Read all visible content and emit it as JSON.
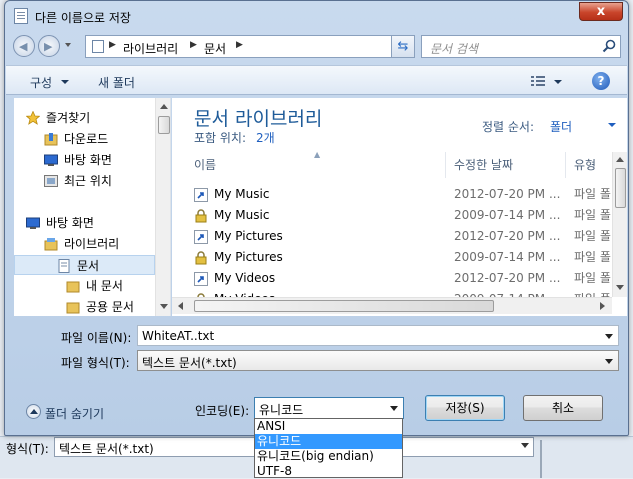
{
  "window": {
    "title": "다른 이름으로 저장",
    "close_label": "x"
  },
  "address": {
    "crumbs": [
      "라이브러리",
      "문서"
    ],
    "search_placeholder": "문서 검색"
  },
  "toolbar": {
    "organize": "구성",
    "new_folder": "새 폴더",
    "help": "?"
  },
  "nav": {
    "items": [
      {
        "label": "즐겨찾기",
        "icon": "star-icon"
      },
      {
        "label": "다운로드",
        "icon": "download-folder-icon"
      },
      {
        "label": "바탕 화면",
        "icon": "desktop-icon"
      },
      {
        "label": "최근 위치",
        "icon": "recent-places-icon"
      },
      {
        "label": "바탕 화면",
        "icon": "desktop-icon"
      },
      {
        "label": "라이브러리",
        "icon": "library-icon"
      },
      {
        "label": "문서",
        "icon": "documents-icon",
        "selected": true
      },
      {
        "label": "내 문서",
        "icon": "folder-icon"
      },
      {
        "label": "공용 문서",
        "icon": "folder-icon"
      }
    ]
  },
  "library": {
    "title": "문서 라이브러리",
    "includes_label": "포함 위치:",
    "includes_value": "2개",
    "sort_label": "정렬 순서:",
    "sort_value": "폴더"
  },
  "columns": {
    "name": "이름",
    "date": "수정한 날짜",
    "type": "유형"
  },
  "files": [
    {
      "name": "My Music",
      "date": "2012-07-20 PM ...",
      "type": "파일 폴더",
      "icon": "shortcut-icon"
    },
    {
      "name": "My Music",
      "date": "2009-07-14 PM ...",
      "type": "파일 폴더",
      "icon": "lock-icon"
    },
    {
      "name": "My Pictures",
      "date": "2012-07-20 PM ...",
      "type": "파일 폴더",
      "icon": "shortcut-icon"
    },
    {
      "name": "My Pictures",
      "date": "2009-07-14 PM ...",
      "type": "파일 폴더",
      "icon": "lock-icon"
    },
    {
      "name": "My Videos",
      "date": "2012-07-20 PM ...",
      "type": "파일 폴더",
      "icon": "shortcut-icon"
    },
    {
      "name": "My Videos",
      "date": "2009-07-14 PM ...",
      "type": "파일 폴더",
      "icon": "lock-icon"
    }
  ],
  "form": {
    "filename_label": "파일 이름(N):",
    "filename_value": "WhiteAT..txt",
    "filetype_label": "파일 형식(T):",
    "filetype_value": "텍스트 문서(*.txt)",
    "encoding_label": "인코딩(E):",
    "encoding_value": "유니코드",
    "hide_folders": "폴더 숨기기",
    "save_button": "저장(S)",
    "cancel_button": "취소"
  },
  "encoding_options": [
    "ANSI",
    "유니코드",
    "유니코드(big endian)",
    "UTF-8"
  ],
  "encoding_selected_index": 1,
  "background": {
    "type_label": "형식(T):",
    "type_value": "텍스트 문서(*.txt)"
  }
}
